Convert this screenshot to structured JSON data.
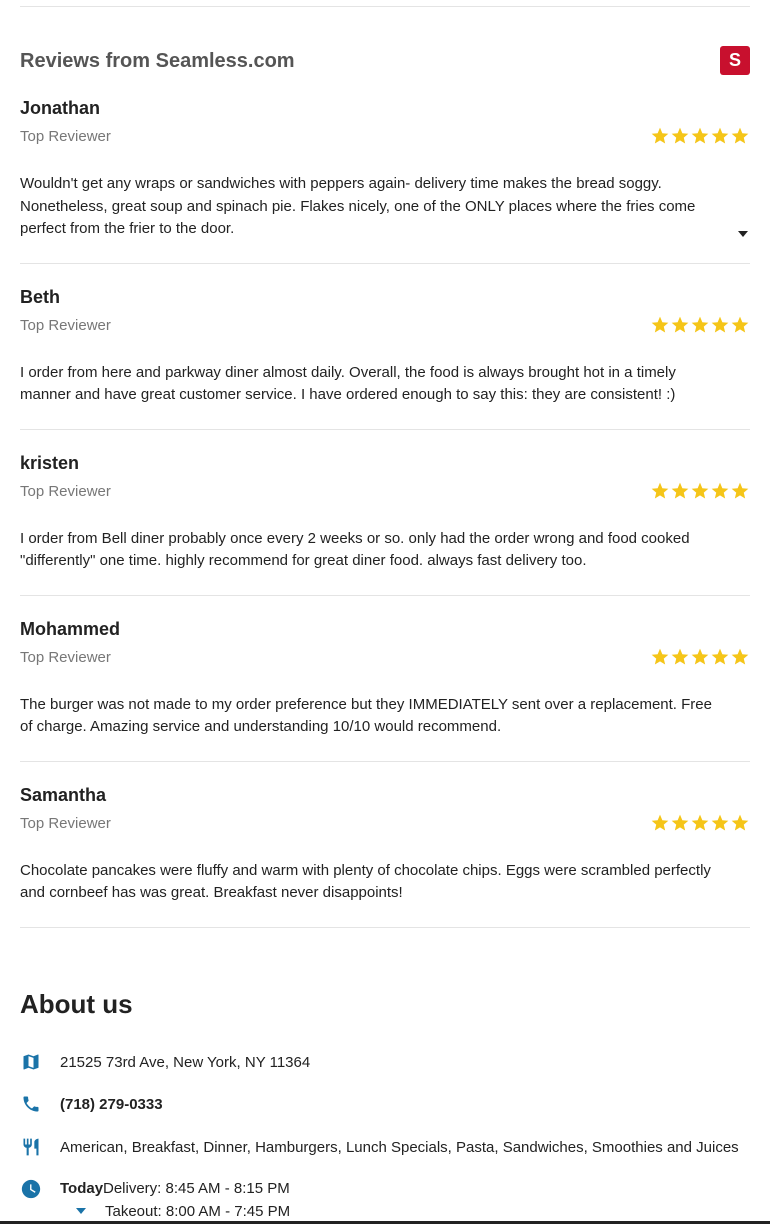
{
  "reviews_section": {
    "title": "Reviews from Seamless.com",
    "source_logo_letter": "S",
    "colors": {
      "star": "#f5c518",
      "logo_bg": "#c8102e"
    }
  },
  "reviews": [
    {
      "name": "Jonathan",
      "badge": "Top Reviewer",
      "rating": 5,
      "text": "Wouldn't get any wraps or sandwiches with peppers again- delivery time makes the bread soggy. Nonetheless, great soup and spinach pie. Flakes nicely, one of the ONLY places where the fries come perfect from the frier to the door.",
      "expandable": true
    },
    {
      "name": "Beth",
      "badge": "Top Reviewer",
      "rating": 5,
      "text": "I order from here and parkway diner almost daily. Overall, the food is always brought hot in a timely manner and have great customer service. I have ordered enough to say this: they are consistent! :)",
      "expandable": false
    },
    {
      "name": "kristen",
      "badge": "Top Reviewer",
      "rating": 5,
      "text": "I order from Bell diner probably once every 2 weeks or so. only had the order wrong and food cooked \"differently\" one time. highly recommend for great diner food. always fast delivery too.",
      "expandable": false
    },
    {
      "name": "Mohammed",
      "badge": "Top Reviewer",
      "rating": 5,
      "text": "The burger was not made to my order preference but they IMMEDIATELY sent over a replacement. Free of charge. Amazing service and understanding 10/10 would recommend.",
      "expandable": false
    },
    {
      "name": "Samantha",
      "badge": "Top Reviewer",
      "rating": 5,
      "text": "Chocolate pancakes were fluffy and warm with plenty of chocolate chips. Eggs were scrambled perfectly and cornbeef has was great. Breakfast never disappoints!",
      "expandable": false
    }
  ],
  "about": {
    "title": "About us",
    "address": "21525 73rd Ave, New York, NY 11364",
    "phone": "(718) 279-0333",
    "cuisines": "American, Breakfast, Dinner, Hamburgers, Lunch Specials, Pasta, Sandwiches, Smoothies and Juices",
    "hours": {
      "today_label": "Today",
      "delivery": "Delivery: 8:45 AM - 8:15 PM",
      "takeout": "Takeout: 8:00 AM - 7:45 PM"
    },
    "icons": {
      "address": "map-icon",
      "phone": "phone-icon",
      "cuisines": "utensils-icon",
      "hours": "clock-icon"
    },
    "icon_color": "#1a73a8"
  }
}
